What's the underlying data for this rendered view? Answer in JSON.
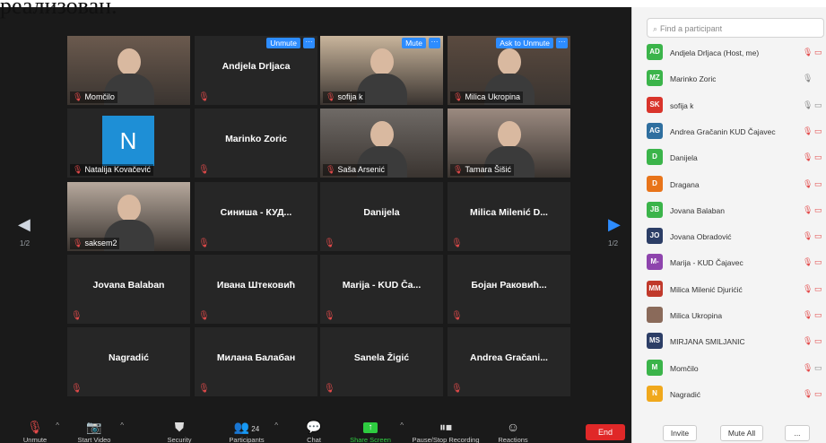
{
  "overlay_text": "реализован.",
  "tiles": [
    {
      "name": "Momčilo",
      "type": "video",
      "label": "Momčilo"
    },
    {
      "name": "Andjela Drljaca",
      "type": "name",
      "button": "Unmute"
    },
    {
      "name": "sofija k",
      "type": "video",
      "label": "sofija k",
      "button": "Mute",
      "active": true
    },
    {
      "name": "Milica Ukropina",
      "type": "video",
      "label": "Milica Ukropina",
      "button": "Ask to Unmute"
    },
    {
      "name": "Natalija Kovačević",
      "type": "avatar",
      "initial": "N",
      "label": "Natalija Kovačević"
    },
    {
      "name": "Marinko Zoric",
      "type": "name"
    },
    {
      "name": "Saša Arsenić",
      "type": "video",
      "label": "Saša Arsenić"
    },
    {
      "name": "Tamara Šišić",
      "type": "video",
      "label": "Tamara Šišić"
    },
    {
      "name": "saksem2",
      "type": "video",
      "label": "saksem2"
    },
    {
      "name": "Синиша - КУД...",
      "type": "name"
    },
    {
      "name": "Danijela",
      "type": "name"
    },
    {
      "name": "Milica Milenić D...",
      "type": "name"
    },
    {
      "name": "Jovana Balaban",
      "type": "name"
    },
    {
      "name": "Ивана Штековић",
      "type": "name"
    },
    {
      "name": "Marija - KUD Ča...",
      "type": "name"
    },
    {
      "name": "Бојан Раковић...",
      "type": "name"
    },
    {
      "name": "Nagradić",
      "type": "name"
    },
    {
      "name": "Милана Балабан",
      "type": "name"
    },
    {
      "name": "Sanela Žigić",
      "type": "name"
    },
    {
      "name": "Andrea Gračani...",
      "type": "name"
    }
  ],
  "pager": {
    "left": "1/2",
    "right": "1/2"
  },
  "toolbar": {
    "unmute": "Unmute",
    "start_video": "Start Video",
    "security": "Security",
    "participants": "Participants",
    "participants_count": "24",
    "chat": "Chat",
    "share_screen": "Share Screen",
    "recording": "Pause/Stop Recording",
    "reactions": "Reactions",
    "end": "End"
  },
  "panel": {
    "search_placeholder": "Find a participant",
    "invite": "Invite",
    "mute_all": "Mute All",
    "more": "..."
  },
  "participants": [
    {
      "initials": "AD",
      "name": "Andjela Drljaca (Host, me)",
      "color": "#3bb44a"
    },
    {
      "initials": "MZ",
      "name": "Marinko Zoric",
      "color": "#3bb44a"
    },
    {
      "initials": "SK",
      "name": "sofija k",
      "color": "#d9342b"
    },
    {
      "initials": "AG",
      "name": "Andrea Gračanin KUD Čajavec",
      "color": "#2f6f9f"
    },
    {
      "initials": "D",
      "name": "Danijela",
      "color": "#3bb44a"
    },
    {
      "initials": "D",
      "name": "Dragana",
      "color": "#e8741a"
    },
    {
      "initials": "JB",
      "name": "Jovana Balaban",
      "color": "#3bb44a"
    },
    {
      "initials": "JO",
      "name": "Jovana Obradović",
      "color": "#2c3e66"
    },
    {
      "initials": "M-",
      "name": "Marija - KUD Čajavec",
      "color": "#8e44ad"
    },
    {
      "initials": "MM",
      "name": "Milica Milenić Djurićić",
      "color": "#c0392b"
    },
    {
      "initials": "",
      "name": "Milica Ukropina",
      "color": "#8a6a5a"
    },
    {
      "initials": "MS",
      "name": "MIRJANA SMILJANIC",
      "color": "#2c3e66"
    },
    {
      "initials": "M",
      "name": "Momčilo",
      "color": "#3bb44a"
    },
    {
      "initials": "N",
      "name": "Nagradić",
      "color": "#f0a81c"
    }
  ]
}
